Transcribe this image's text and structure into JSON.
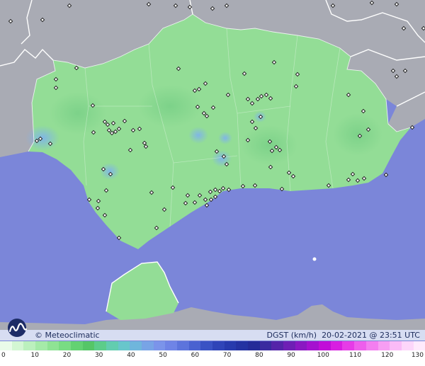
{
  "map": {
    "variable_label": "DGST (km/h)",
    "datetime": "20-02-2021 @ 23:51 UTC",
    "credit": "© Meteoclimatic",
    "logo_icon": "meteoclimatic-logo",
    "colors": {
      "sea": "#7b86d9",
      "land_outside": "#a9abb4",
      "region": "#93dd96",
      "border": "#ffffff"
    }
  },
  "legend": {
    "ticks": [
      "0",
      "10",
      "20",
      "30",
      "40",
      "50",
      "60",
      "70",
      "80",
      "90",
      "100",
      "110",
      "120",
      "130"
    ],
    "colors": [
      "#e9fbe9",
      "#d3f6d3",
      "#bbf0bd",
      "#a5eaa8",
      "#8fe394",
      "#79dc83",
      "#63d272",
      "#55c667",
      "#5ccd8a",
      "#62cdaf",
      "#68c6cb",
      "#6fb6dc",
      "#78a4e6",
      "#7b94ea",
      "#6f84e6",
      "#5d74dc",
      "#4a62d0",
      "#3a52c4",
      "#2f44b8",
      "#273aad",
      "#2432a2",
      "#242b98",
      "#3a2a9f",
      "#5424a9",
      "#6e1fb5",
      "#8a18c2",
      "#a511cf",
      "#c10ed8",
      "#d81ee1",
      "#e63ce7",
      "#ee5eec",
      "#f37ef0",
      "#f79ef3",
      "#fabbf7",
      "#fdd6fa",
      "#ffeafc"
    ]
  }
}
